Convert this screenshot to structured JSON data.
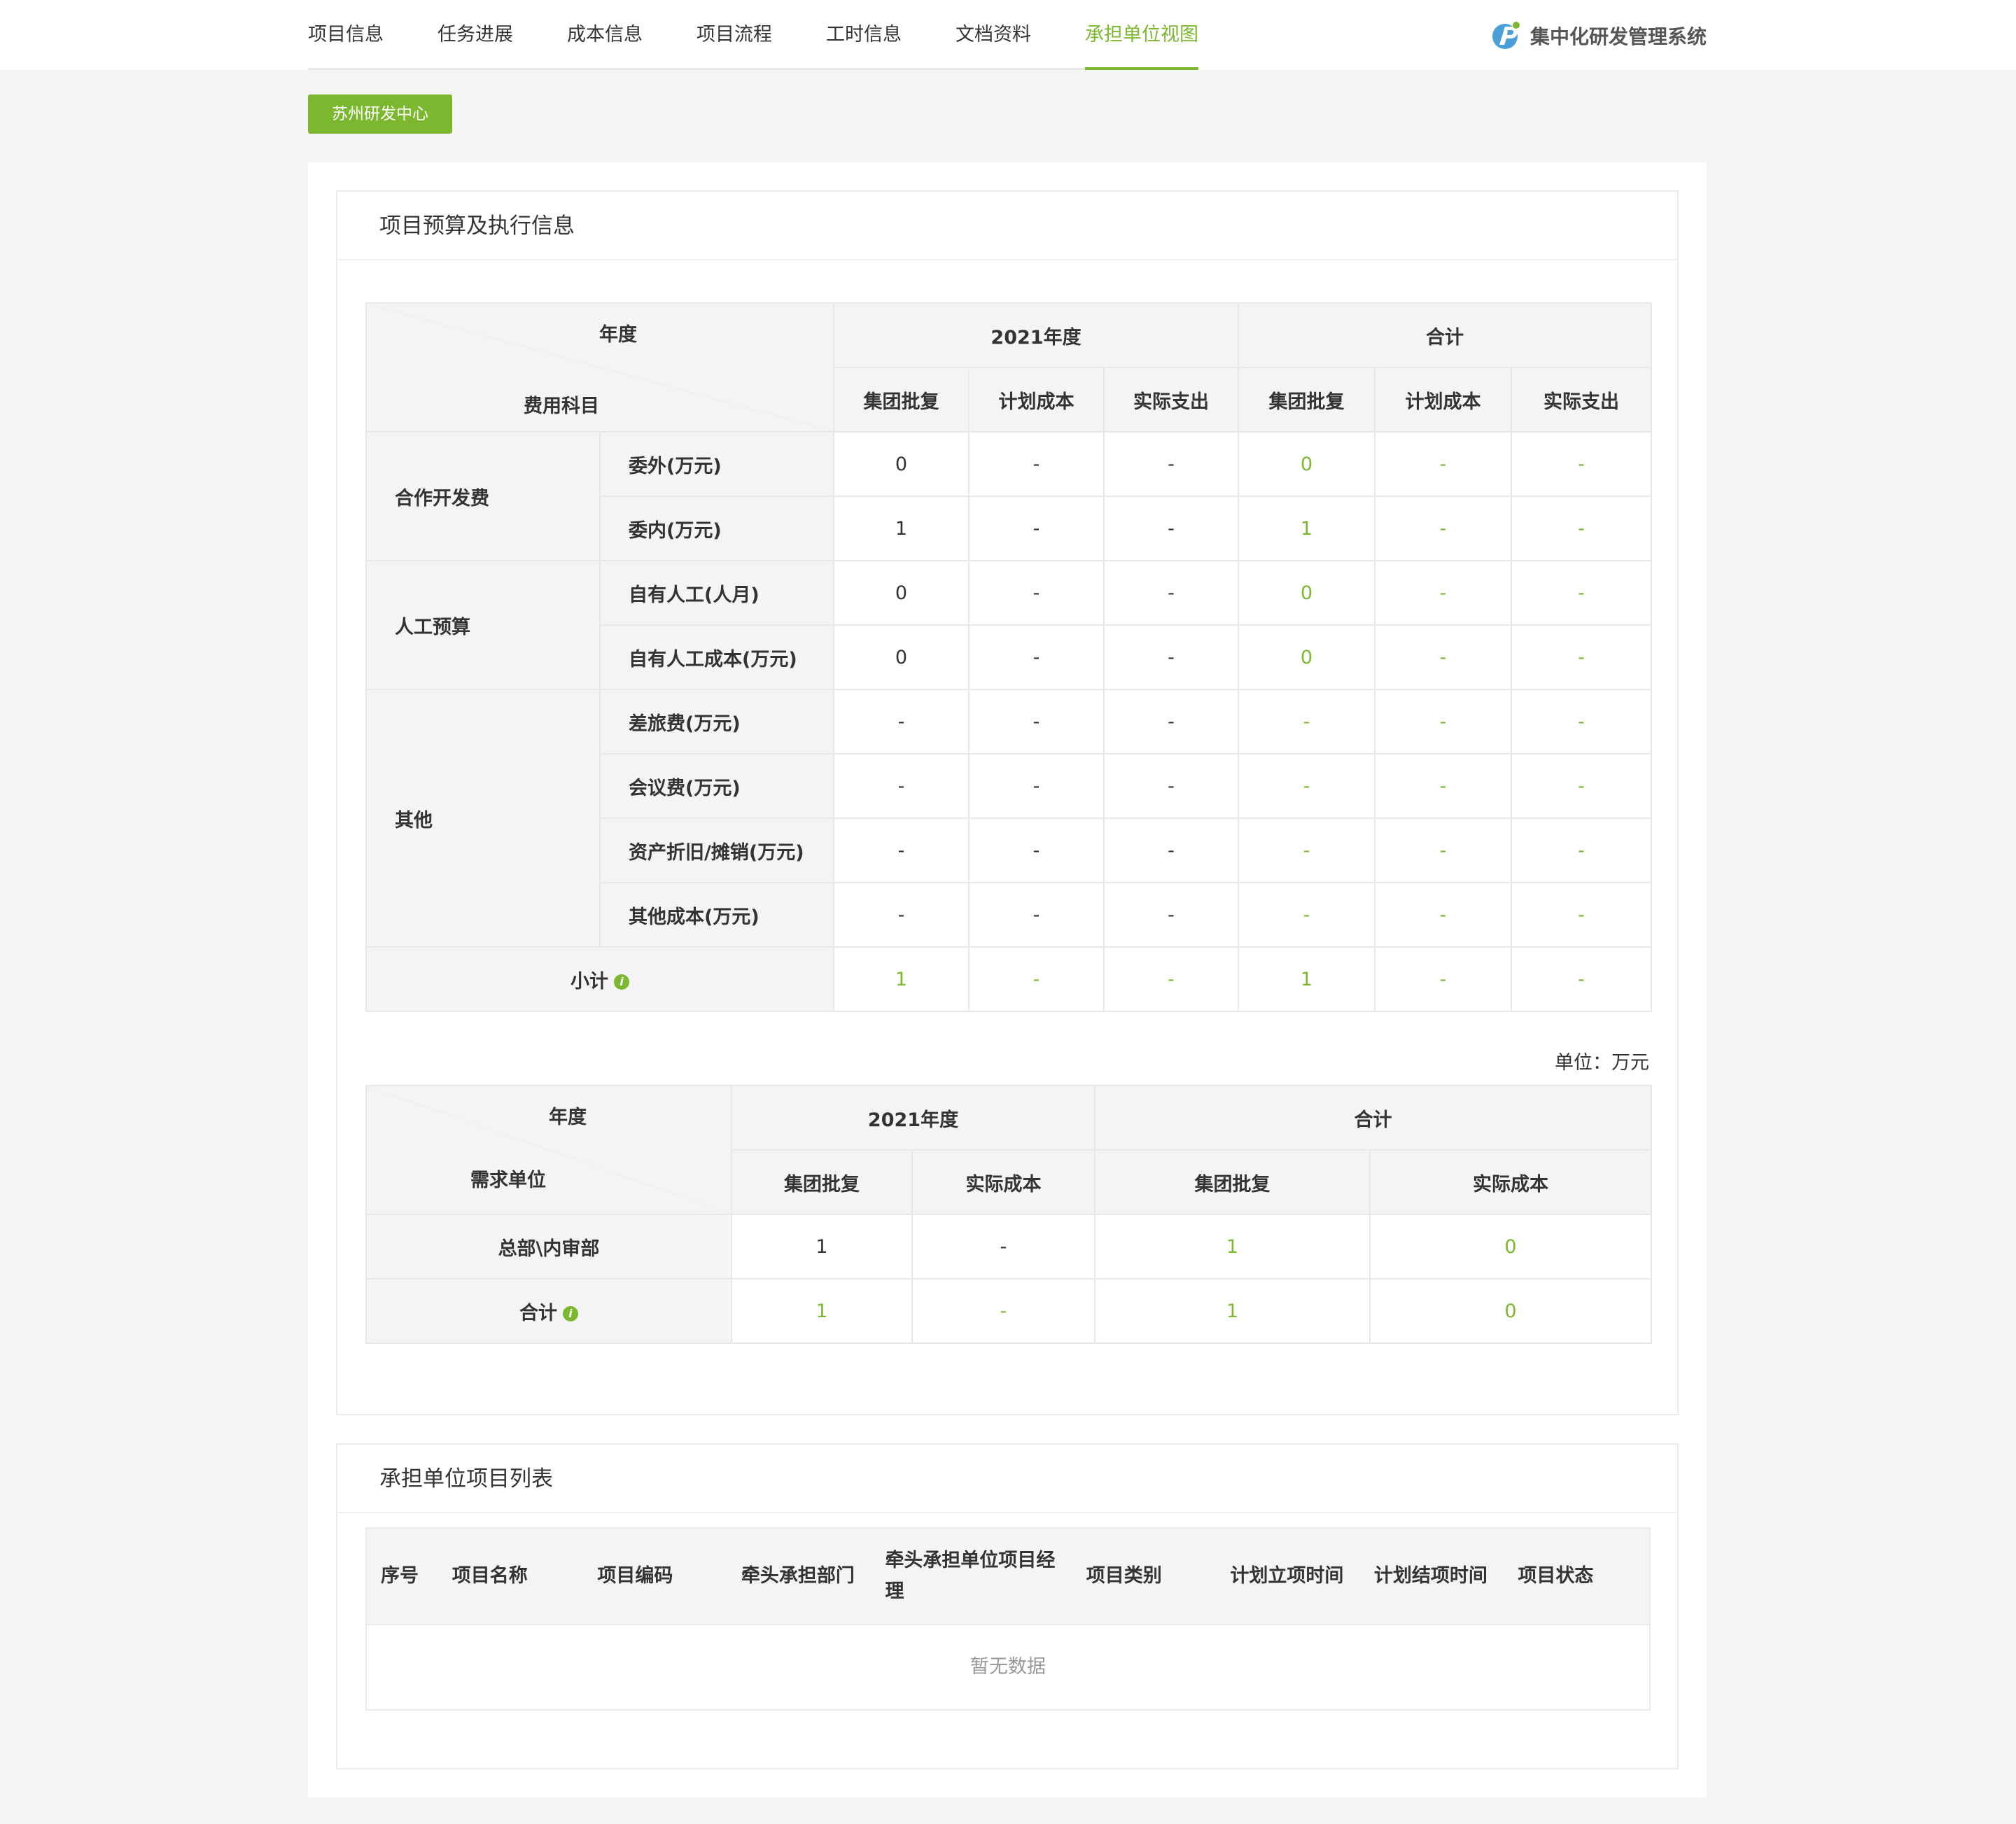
{
  "nav": {
    "tabs": [
      "项目信息",
      "任务进展",
      "成本信息",
      "项目流程",
      "工时信息",
      "文档资料",
      "承担单位视图"
    ],
    "active_tab": "承担单位视图",
    "brand_name": "集中化研发管理系统"
  },
  "unit_button": "苏州研发中心",
  "accent_color": "#7cb82f",
  "budget_card": {
    "title": "项目预算及执行信息",
    "table1": {
      "corner_top": "年度",
      "corner_bottom": "费用科目",
      "year_header": "2021年度",
      "total_header": "合计",
      "sub_headers": [
        "集团批复",
        "计划成本",
        "实际支出"
      ],
      "groups": [
        {
          "name": "合作开发费",
          "rows": [
            {
              "label": "委外(万元)",
              "year": [
                "0",
                "-",
                "-"
              ],
              "total": [
                "0",
                "-",
                "-"
              ]
            },
            {
              "label": "委内(万元)",
              "year": [
                "1",
                "-",
                "-"
              ],
              "total": [
                "1",
                "-",
                "-"
              ]
            }
          ]
        },
        {
          "name": "人工预算",
          "rows": [
            {
              "label": "自有人工(人月)",
              "year": [
                "0",
                "-",
                "-"
              ],
              "total": [
                "0",
                "-",
                "-"
              ]
            },
            {
              "label": "自有人工成本(万元)",
              "year": [
                "0",
                "-",
                "-"
              ],
              "total": [
                "0",
                "-",
                "-"
              ]
            }
          ]
        },
        {
          "name": "其他",
          "rows": [
            {
              "label": "差旅费(万元)",
              "year": [
                "-",
                "-",
                "-"
              ],
              "total": [
                "-",
                "-",
                "-"
              ]
            },
            {
              "label": "会议费(万元)",
              "year": [
                "-",
                "-",
                "-"
              ],
              "total": [
                "-",
                "-",
                "-"
              ]
            },
            {
              "label": "资产折旧/摊销(万元)",
              "year": [
                "-",
                "-",
                "-"
              ],
              "total": [
                "-",
                "-",
                "-"
              ]
            },
            {
              "label": "其他成本(万元)",
              "year": [
                "-",
                "-",
                "-"
              ],
              "total": [
                "-",
                "-",
                "-"
              ]
            }
          ]
        }
      ],
      "subtotal": {
        "label": "小计",
        "year": [
          "1",
          "-",
          "-"
        ],
        "total": [
          "1",
          "-",
          "-"
        ]
      }
    },
    "unit_label": "单位：万元",
    "table2": {
      "corner_top": "年度",
      "corner_bottom": "需求单位",
      "year_header": "2021年度",
      "total_header": "合计",
      "sub_headers": [
        "集团批复",
        "实际成本"
      ],
      "rows": [
        {
          "label": "总部\\内审部",
          "year": [
            "1",
            "-"
          ],
          "total": [
            "1",
            "0"
          ]
        }
      ],
      "sum": {
        "label": "合计",
        "year": [
          "1",
          "-"
        ],
        "total": [
          "1",
          "0"
        ]
      }
    }
  },
  "list_card": {
    "title": "承担单位项目列表",
    "columns": [
      "序号",
      "项目名称",
      "项目编码",
      "牵头承担部门",
      "牵头承担单位项目经理",
      "项目类别",
      "计划立项时间",
      "计划结项时间",
      "项目状态"
    ],
    "empty_text": "暂无数据"
  }
}
